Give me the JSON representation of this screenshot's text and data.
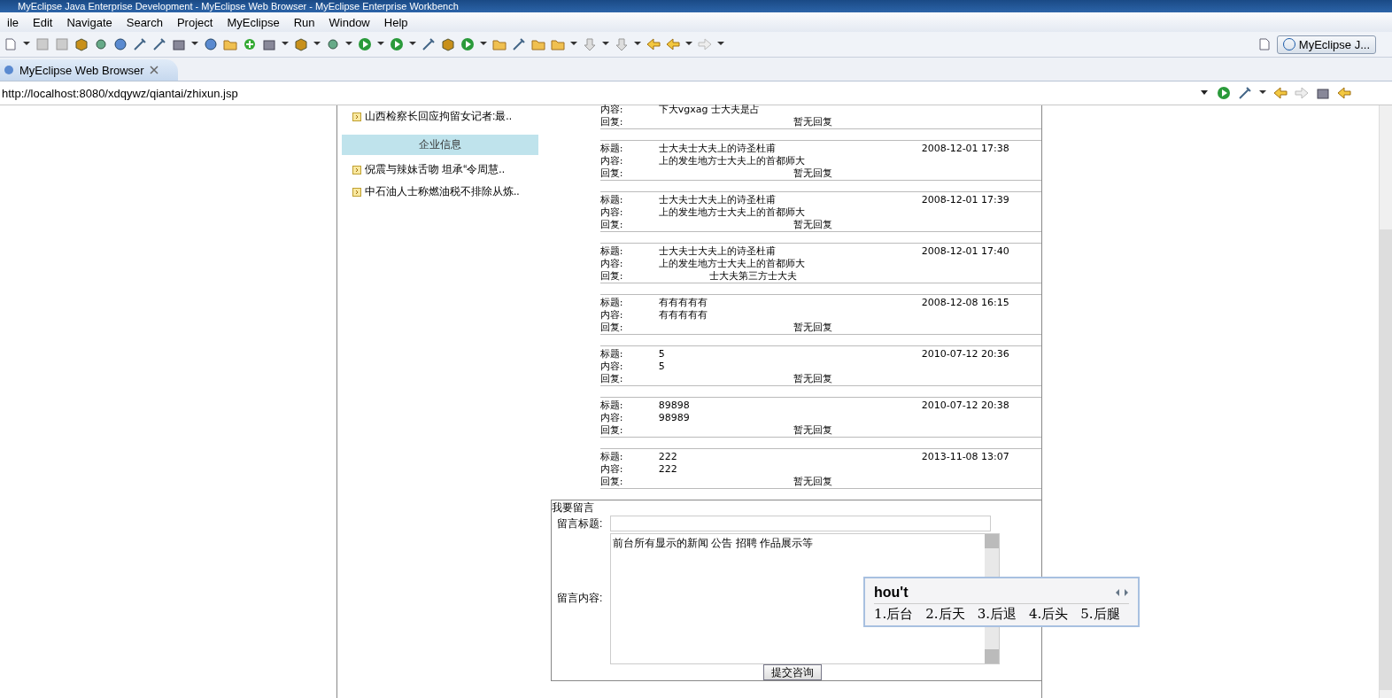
{
  "window": {
    "title": "MyEclipse Java Enterprise Development - MyEclipse Web Browser - MyEclipse Enterprise Workbench"
  },
  "menu": [
    "ile",
    "Edit",
    "Navigate",
    "Search",
    "Project",
    "MyEclipse",
    "Run",
    "Window",
    "Help"
  ],
  "perspective_button": "MyEclipse J...",
  "editor_tabs": [
    {
      "label": "MyEclipse Web Browser",
      "selected": true
    }
  ],
  "address_bar": {
    "value": "http://localhost:8080/xdqywz/qiantai/zhixun.jsp"
  },
  "sidebar": {
    "items_top": [
      "山西检察长回应拘留女记者:最.."
    ],
    "section_title": "企业信息",
    "items": [
      "倪震与辣妹舌吻 坦承“令周慧..",
      "中石油人士称燃油税不排除从炼.."
    ]
  },
  "messages": [
    {
      "rows": [
        {
          "kind": "field",
          "label": "内容:",
          "value": "下大vgxag 士大夫是占"
        },
        {
          "kind": "reply",
          "label": "回复:",
          "value": "暂无回复"
        }
      ]
    },
    {
      "rows": [
        {
          "kind": "field",
          "label": "标题:",
          "value": "士大夫士大夫上的诗圣杜甫",
          "time": "2008-12-01 17:38"
        },
        {
          "kind": "field",
          "label": "内容:",
          "value": "上的发生地方士大夫上的首都师大"
        },
        {
          "kind": "reply",
          "label": "回复:",
          "value": "暂无回复"
        }
      ]
    },
    {
      "rows": [
        {
          "kind": "field",
          "label": "标题:",
          "value": "士大夫士大夫上的诗圣杜甫",
          "time": "2008-12-01 17:39"
        },
        {
          "kind": "field",
          "label": "内容:",
          "value": "上的发生地方士大夫上的首都师大"
        },
        {
          "kind": "reply",
          "label": "回复:",
          "value": "暂无回复"
        }
      ]
    },
    {
      "rows": [
        {
          "kind": "field",
          "label": "标题:",
          "value": "士大夫士大夫上的诗圣杜甫",
          "time": "2008-12-01 17:40"
        },
        {
          "kind": "field",
          "label": "内容:",
          "value": "上的发生地方士大夫上的首都师大"
        },
        {
          "kind": "answer",
          "label": "回复:",
          "value": "士大夫第三方士大夫"
        }
      ]
    },
    {
      "rows": [
        {
          "kind": "field",
          "label": "标题:",
          "value": "有有有有有",
          "time": "2008-12-08 16:15"
        },
        {
          "kind": "field",
          "label": "内容:",
          "value": "有有有有有"
        },
        {
          "kind": "reply",
          "label": "回复:",
          "value": "暂无回复"
        }
      ]
    },
    {
      "rows": [
        {
          "kind": "field",
          "label": "标题:",
          "value": "5",
          "time": "2010-07-12 20:36"
        },
        {
          "kind": "field",
          "label": "内容:",
          "value": "5"
        },
        {
          "kind": "reply",
          "label": "回复:",
          "value": "暂无回复"
        }
      ]
    },
    {
      "rows": [
        {
          "kind": "field",
          "label": "标题:",
          "value": "89898",
          "time": "2010-07-12 20:38"
        },
        {
          "kind": "field",
          "label": "内容:",
          "value": "98989"
        },
        {
          "kind": "reply",
          "label": "回复:",
          "value": "暂无回复"
        }
      ]
    },
    {
      "rows": [
        {
          "kind": "field",
          "label": "标题:",
          "value": "222",
          "time": "2013-11-08 13:07"
        },
        {
          "kind": "field",
          "label": "内容:",
          "value": "222"
        },
        {
          "kind": "reply",
          "label": "回复:",
          "value": "暂无回复"
        }
      ]
    }
  ],
  "message_form": {
    "legend": "我要留言",
    "title_label": "留言标题:",
    "content_label": "留言内容:",
    "content_value": "前台所有显示的新闻 公告 招聘 作品展示等",
    "submit": "提交咨询"
  },
  "ime": {
    "input": "hou't",
    "candidates": [
      "1.后台",
      "2.后天",
      "3.后退",
      "4.后头",
      "5.后腿"
    ]
  }
}
